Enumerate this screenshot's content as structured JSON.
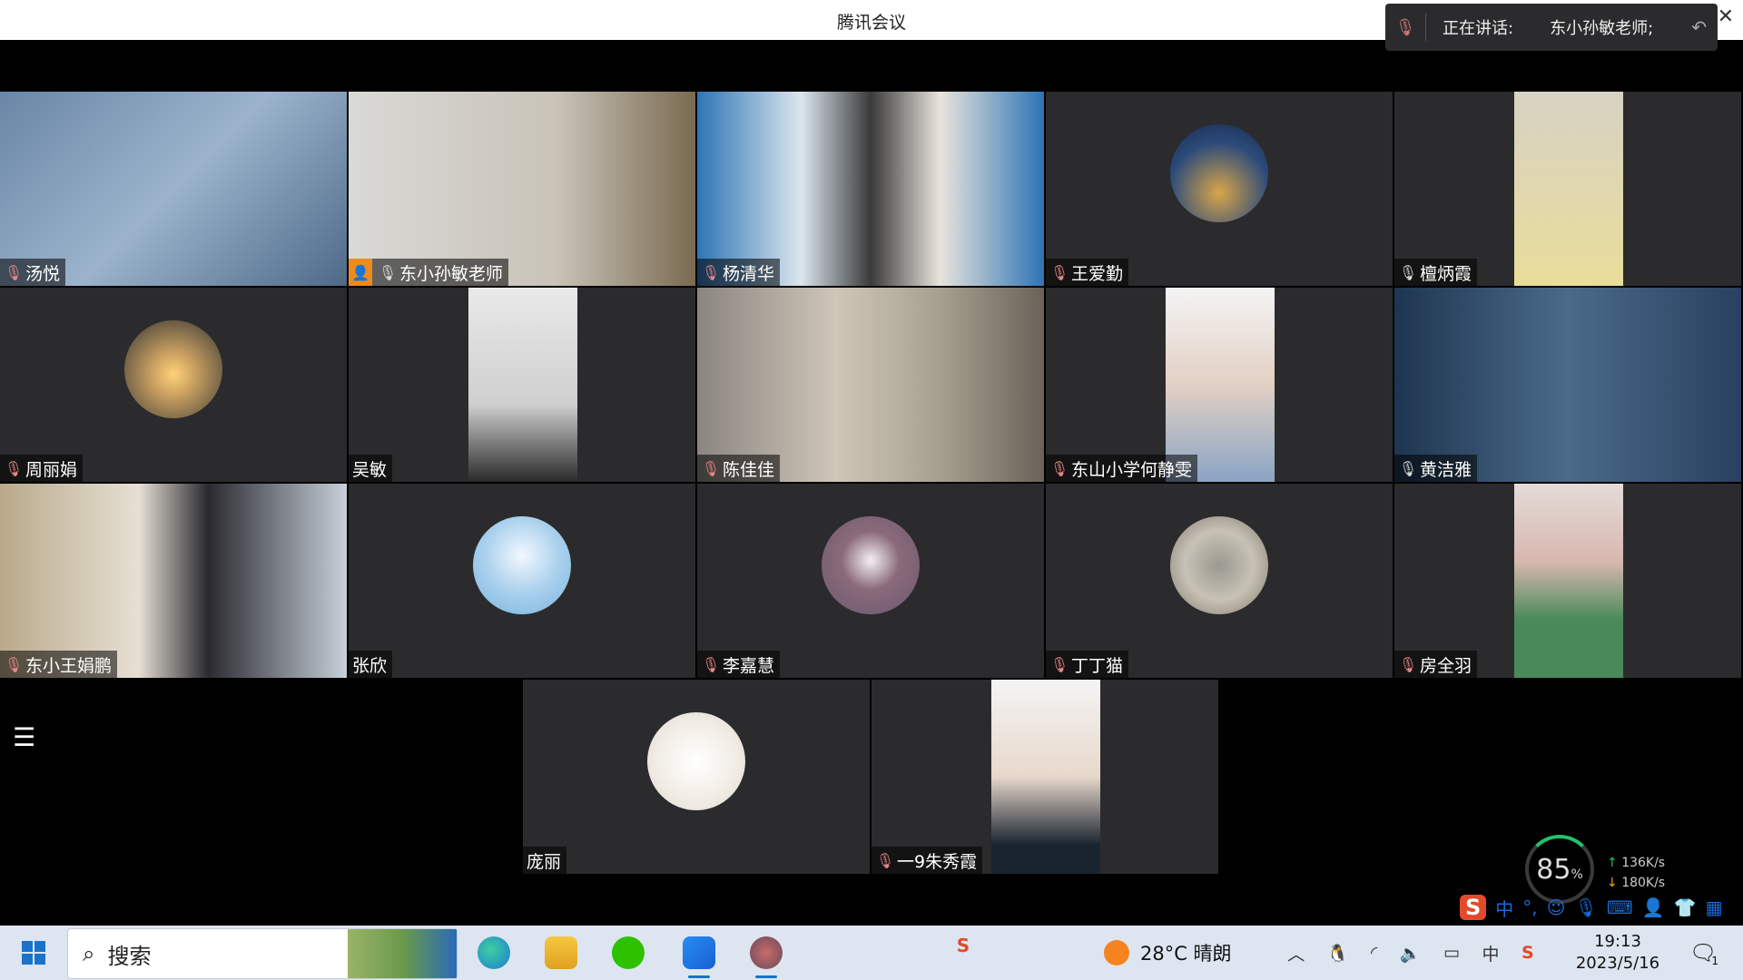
{
  "window": {
    "title": "腾讯会议"
  },
  "speaking": {
    "label": "正在讲话:",
    "name": "东小孙敏老师;"
  },
  "participants": [
    {
      "name": "汤悦",
      "mic": "muted"
    },
    {
      "name": "东小孙敏老师",
      "mic": "on",
      "host": true,
      "speaking": true
    },
    {
      "name": "杨清华",
      "mic": "muted"
    },
    {
      "name": "王爱勤",
      "mic": "muted"
    },
    {
      "name": "檀炳霞",
      "mic": "on"
    },
    {
      "name": "周丽娟",
      "mic": "muted"
    },
    {
      "name": "吴敏",
      "mic": "none"
    },
    {
      "name": "陈佳佳",
      "mic": "muted"
    },
    {
      "name": "东山小学何静雯",
      "mic": "muted"
    },
    {
      "name": "黄洁雅",
      "mic": "on"
    },
    {
      "name": "东小王娟鹏",
      "mic": "muted"
    },
    {
      "name": "张欣",
      "mic": "none"
    },
    {
      "name": "李嘉慧",
      "mic": "muted"
    },
    {
      "name": "丁丁猫",
      "mic": "muted"
    },
    {
      "name": "房全羽",
      "mic": "muted"
    },
    {
      "name": "庞丽",
      "mic": "none"
    },
    {
      "name": "一9朱秀霞",
      "mic": "muted"
    }
  ],
  "network": {
    "percent": "85",
    "unit": "%",
    "upload": "136K/s",
    "download": "180K/s"
  },
  "ime": {
    "mode": "中"
  },
  "taskbar": {
    "search_placeholder": "搜索",
    "weather": "28°C 晴朗",
    "time": "19:13",
    "date": "2023/5/16",
    "input_lang": "中",
    "notification_count": "1"
  },
  "colors": {
    "speaking_border": "#3bbf4a",
    "host_badge": "#f08a1c",
    "tile_bg": "#2b2b2d"
  }
}
